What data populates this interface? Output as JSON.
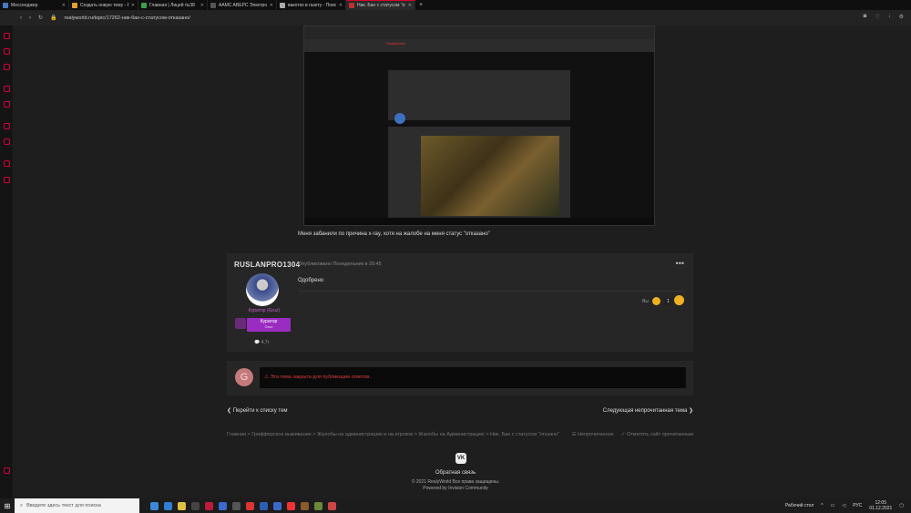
{
  "browser": {
    "tabs": [
      {
        "label": "Мессенджер",
        "color": "#4a78c4"
      },
      {
        "label": "Создать новую тему - Ro",
        "color": "#e0a030"
      },
      {
        "label": "Главная | Лицей №38",
        "color": "#3aa04a"
      },
      {
        "label": "AAMC ABEPC Электронн",
        "color": "#555"
      },
      {
        "label": "вакотко в газету - Поиск",
        "color": "#aaa"
      },
      {
        "label": "Ник. Бан с статусом \"откв",
        "color": "#c03030"
      }
    ],
    "url": "realyworld.ru/topic/17262-ник-бан-с-статусом-отказано/"
  },
  "screenshot_text": {
    "site_logo": "RealyWorld"
  },
  "post_caption": "Меня забанили по причина x-ray, хотя на жалобе на меня статус \"отказано\"",
  "post": {
    "author": "RUSLANPRO1304",
    "published": "Опубликовано Понедельник в 20:45",
    "message": "Одобрено",
    "role_title": "Куратор (Gruz)",
    "role_badge": "Куратор",
    "role_badge_sub": "Gruz",
    "reputation": "4,7т",
    "likes_label": "Вы",
    "likes_count": "1"
  },
  "closed": {
    "avatar_letter": "G",
    "message": "Эта тема закрыта для публикации ответов."
  },
  "navigation": {
    "prev": "Перейти к списку тем",
    "next": "Следующая непрочитанная тема"
  },
  "breadcrumbs": "Главная > Грифферское выживание > Жалобы на администрацию и на игроков > Жалобы на Администрацию > Ник. Бан с статусом \"откзано\"",
  "breadcrumb_actions": {
    "unread": "Непрочитанное",
    "mark_read": "Отметить сайт прочитанным"
  },
  "footer": {
    "vk": "VK",
    "feedback": "Обратная связь",
    "copyright": "© 2021 RealyWorld Все права защищены.",
    "powered": "Powered by Invision Community"
  },
  "taskbar": {
    "search_placeholder": "Введите здесь текст для поиска",
    "desktop_label": "Рабочий стол",
    "lang": "РУС",
    "time": "12:05",
    "date": "01.12.2021"
  }
}
